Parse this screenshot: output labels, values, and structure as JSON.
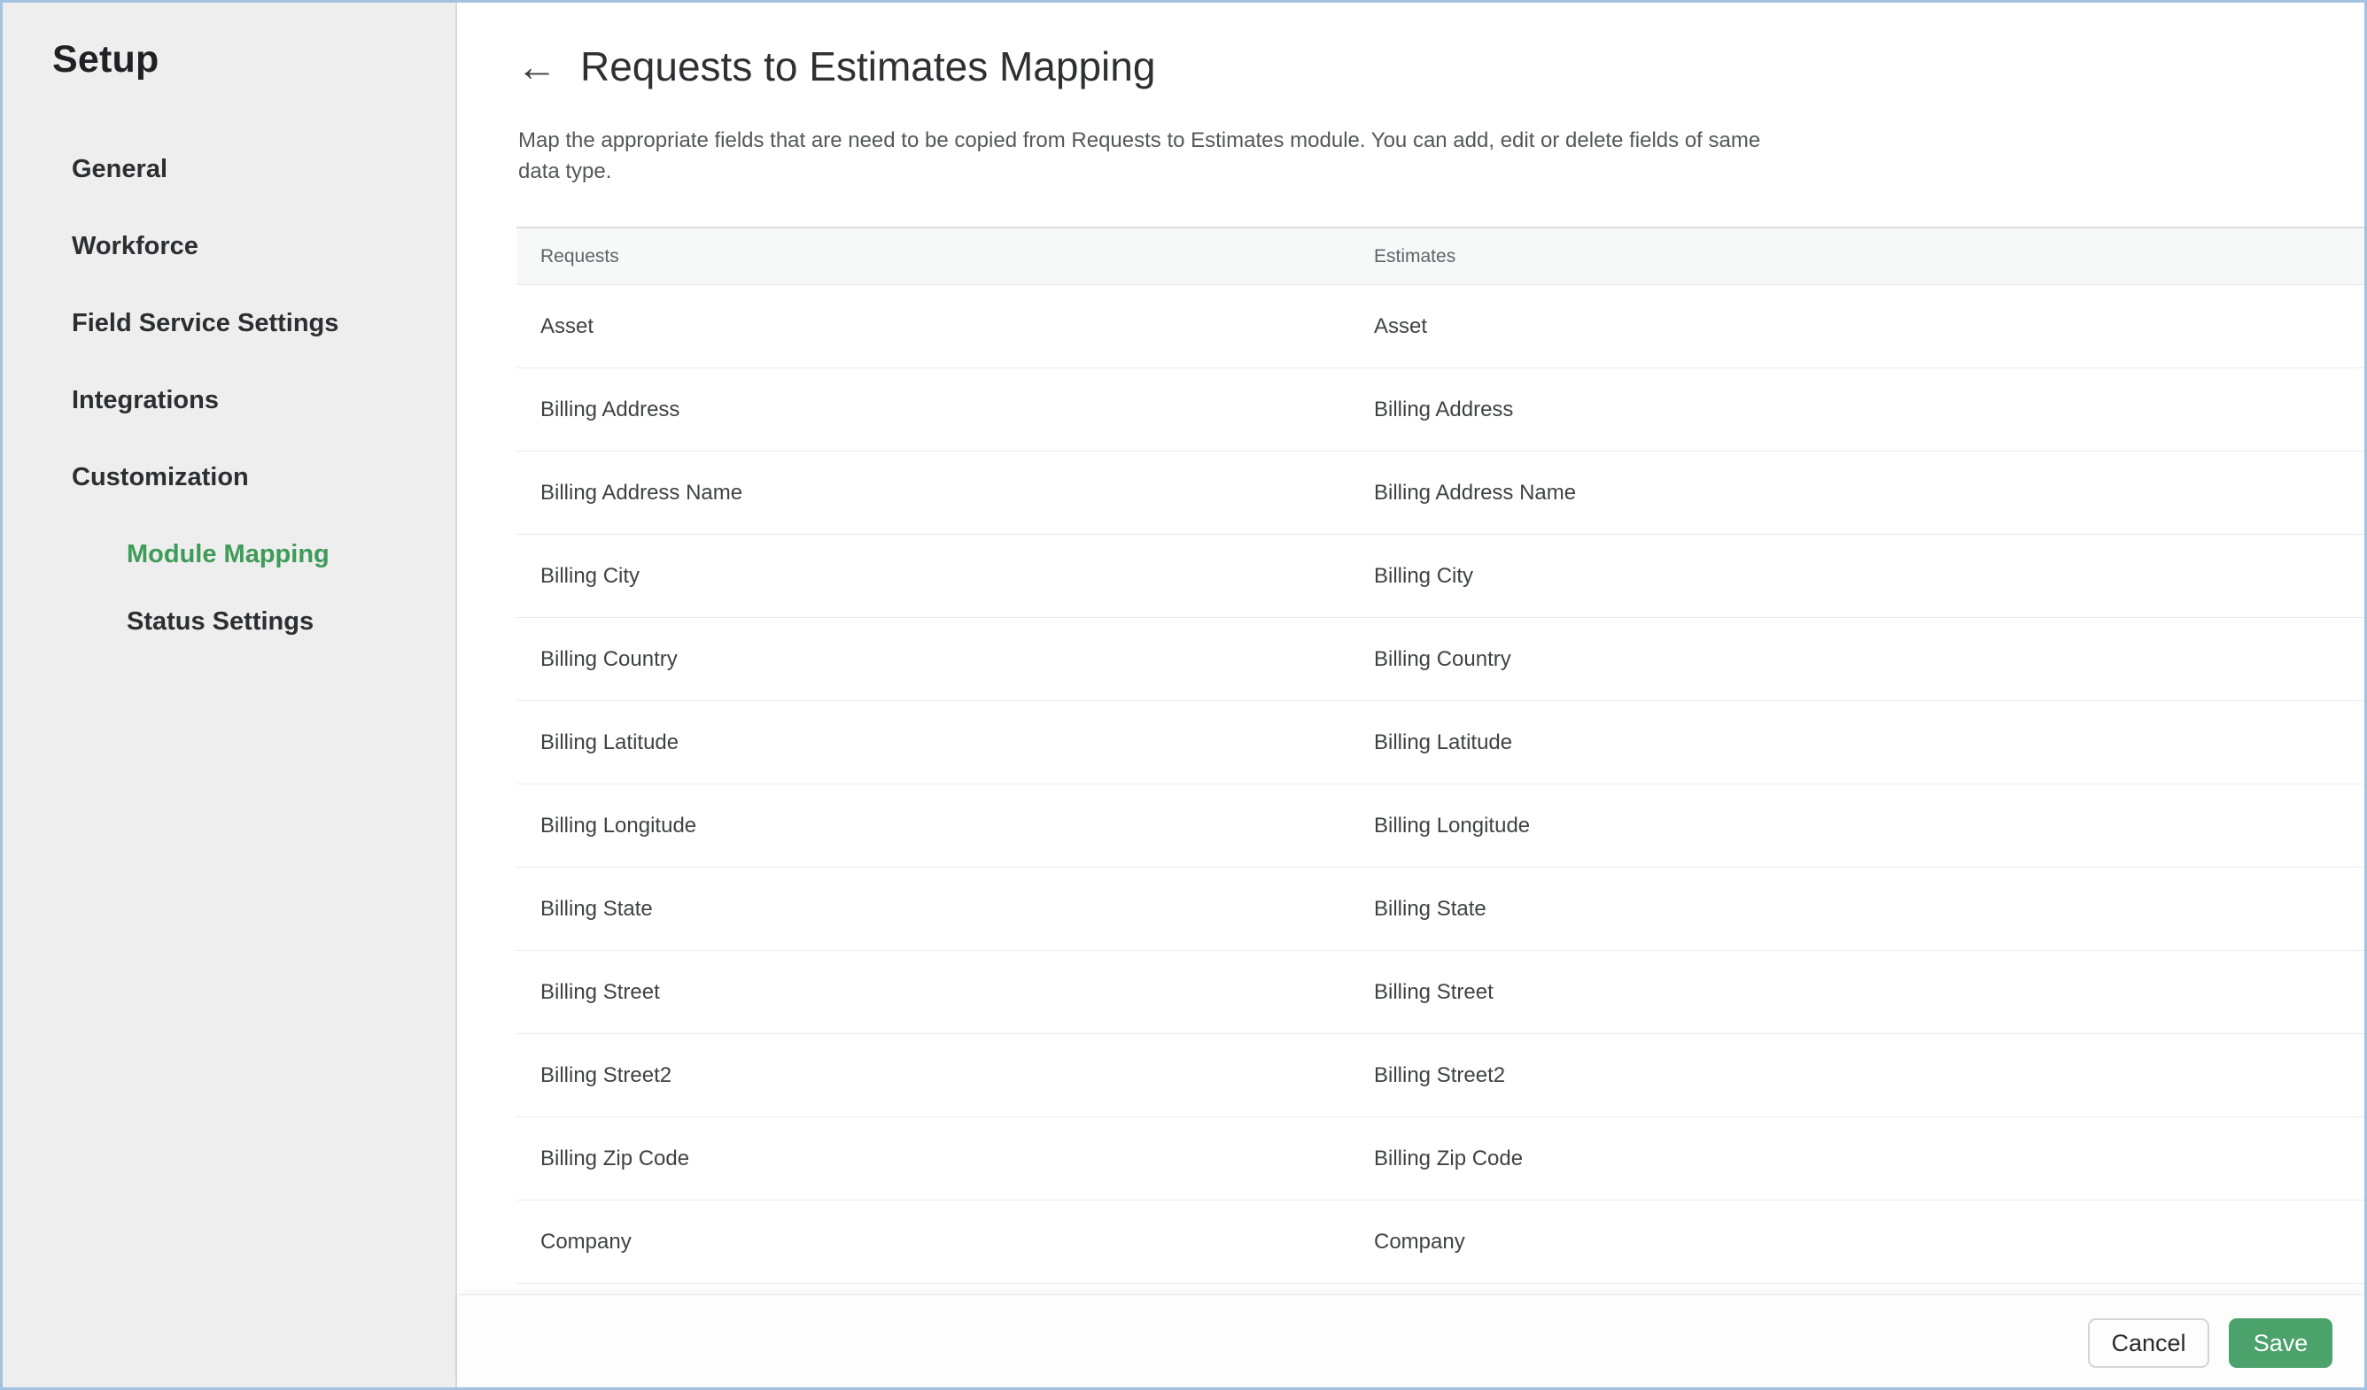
{
  "window": {
    "border_color": "#a4c2df"
  },
  "sidebar": {
    "title": "Setup",
    "active_color": "#3f9b58",
    "items": [
      {
        "label": "General",
        "level": 1,
        "active": false
      },
      {
        "label": "Workforce",
        "level": 1,
        "active": false
      },
      {
        "label": "Field Service Settings",
        "level": 1,
        "active": false
      },
      {
        "label": "Integrations",
        "level": 1,
        "active": false
      },
      {
        "label": "Customization",
        "level": 1,
        "active": false
      },
      {
        "label": "Module Mapping",
        "level": 2,
        "active": true
      },
      {
        "label": "Status Settings",
        "level": 2,
        "active": false
      }
    ]
  },
  "header": {
    "back_icon": "←",
    "title": "Requests to Estimates Mapping",
    "description": "Map the appropriate fields that are need to be copied from Requests to Estimates module. You can add, edit or delete fields of same data type."
  },
  "table": {
    "columns": [
      "Requests",
      "Estimates"
    ],
    "rows": [
      {
        "requests": "Asset",
        "estimates": "Asset"
      },
      {
        "requests": "Billing Address",
        "estimates": "Billing Address"
      },
      {
        "requests": "Billing Address Name",
        "estimates": "Billing Address Name"
      },
      {
        "requests": "Billing City",
        "estimates": "Billing City"
      },
      {
        "requests": "Billing Country",
        "estimates": "Billing Country"
      },
      {
        "requests": "Billing Latitude",
        "estimates": "Billing Latitude"
      },
      {
        "requests": "Billing Longitude",
        "estimates": "Billing Longitude"
      },
      {
        "requests": "Billing State",
        "estimates": "Billing State"
      },
      {
        "requests": "Billing Street",
        "estimates": "Billing Street"
      },
      {
        "requests": "Billing Street2",
        "estimates": "Billing Street2"
      },
      {
        "requests": "Billing Zip Code",
        "estimates": "Billing Zip Code"
      },
      {
        "requests": "Company",
        "estimates": "Company"
      }
    ]
  },
  "footer": {
    "cancel_label": "Cancel",
    "save_label": "Save",
    "save_color": "#4ba26b"
  }
}
